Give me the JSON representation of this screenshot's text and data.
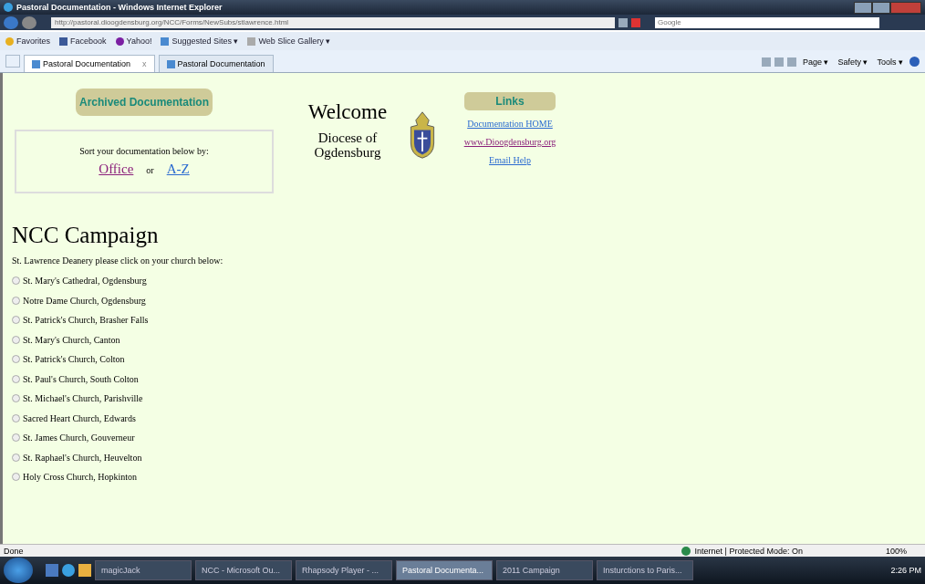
{
  "window": {
    "title": "Pastoral Documentation - Windows Internet Explorer"
  },
  "address_bar": {
    "url": "http://pastoral.dioogdensburg.org/NCC/Forms/NewSubs/stlawrence.html",
    "search_placeholder": "Google"
  },
  "favorites_bar": {
    "items": [
      {
        "kind": "star",
        "label": "Favorites"
      },
      {
        "kind": "facebook",
        "label": "Facebook"
      },
      {
        "kind": "yahoo",
        "label": "Yahoo!"
      },
      {
        "kind": "ie",
        "label": "Suggested Sites ▾"
      },
      {
        "kind": "page",
        "label": "Web Slice Gallery ▾"
      }
    ]
  },
  "tabs": [
    {
      "label": "Pastoral Documentation",
      "selected": true,
      "close": "x"
    },
    {
      "label": "Pastoral Documentation",
      "selected": false
    }
  ],
  "command_bar": [
    "Page ▾",
    "Safety ▾",
    "Tools ▾"
  ],
  "page": {
    "archived_button": "Archived Documentation",
    "sort_text": "Sort your documentation below by:",
    "sort_links": [
      {
        "label": "Office",
        "visited": true
      },
      {
        "label": "A-Z",
        "visited": false
      }
    ],
    "or": "or",
    "welcome": "Welcome",
    "diocese": "Diocese of Ogdensburg",
    "links_heading": "Links",
    "links": [
      {
        "label": "Documentation HOME",
        "visited": false
      },
      {
        "label": "www.Dioogdensburg.org",
        "visited": true
      },
      {
        "label": "Email Help",
        "visited": false
      }
    ],
    "heading": "NCC Campaign",
    "instruction": "St. Lawrence Deanery please click on your church below:",
    "churches": [
      {
        "label": "St. Mary's Cathedral, Ogdensburg",
        "selected": false
      },
      {
        "label": "Notre Dame Church, Ogdensburg",
        "selected": false
      },
      {
        "label": "St. Patrick's Church, Brasher Falls",
        "selected": false
      },
      {
        "label": "St. Mary's Church, Canton",
        "selected": false
      },
      {
        "label": "St. Patrick's Church, Colton",
        "selected": false
      },
      {
        "label": "St. Paul's Church, South Colton",
        "selected": false
      },
      {
        "label": "St. Michael's Church, Parishville",
        "selected": false
      },
      {
        "label": "Sacred Heart Church, Edwards",
        "selected": false
      },
      {
        "label": "St. James Church, Gouverneur",
        "selected": false
      },
      {
        "label": "St. Raphael's Church, Heuvelton",
        "selected": false
      },
      {
        "label": "Holy Cross Church, Hopkinton",
        "selected": false
      }
    ]
  },
  "status_bar": {
    "text": "Done",
    "zone": "Internet | Protected Mode: On",
    "zoom": "100%"
  },
  "taskbar": {
    "items": [
      {
        "label": "magicJack",
        "selected": false
      },
      {
        "label": "NCC - Microsoft Ou...",
        "selected": false
      },
      {
        "label": "Rhapsody Player - ...",
        "selected": false
      },
      {
        "label": "Pastoral Documenta...",
        "selected": true
      },
      {
        "label": "2011 Campaign",
        "selected": false
      },
      {
        "label": "Insturctions to Paris...",
        "selected": false
      }
    ],
    "clock": "2:26 PM"
  }
}
